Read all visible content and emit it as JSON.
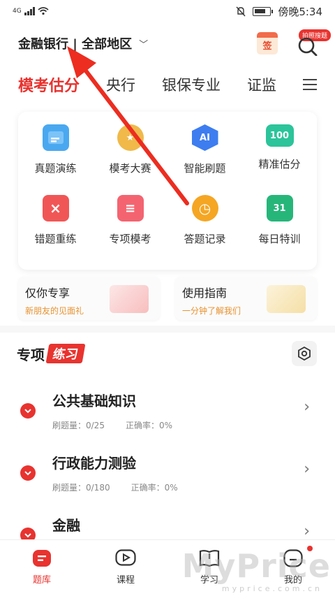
{
  "status_bar": {
    "network": "4G",
    "time": "傍晚5:34"
  },
  "header": {
    "region": "金融银行 | 全部地区",
    "calendar_label": "签",
    "photo_search_badge": "拍照搜题"
  },
  "tabs": [
    "模考估分",
    "央行",
    "银保专业",
    "证监"
  ],
  "grid": [
    {
      "label": "真题演练",
      "icon": "document-icon",
      "color": "#4aa8f0",
      "glyph": ""
    },
    {
      "label": "模考大赛",
      "icon": "medal-icon",
      "color": "#f0b94a",
      "glyph": "★"
    },
    {
      "label": "智能刷题",
      "icon": "ai-icon",
      "color": "#3d7df0",
      "glyph": "AI"
    },
    {
      "label": "精准估分",
      "icon": "score-icon",
      "color": "#2cc49a",
      "glyph": "100"
    },
    {
      "label": "错题重练",
      "icon": "error-icon",
      "color": "#f15656",
      "glyph": "×"
    },
    {
      "label": "专项模考",
      "icon": "certificate-icon",
      "color": "#f36470",
      "glyph": "≡"
    },
    {
      "label": "答题记录",
      "icon": "alarm-clock-icon",
      "color": "#f5a623",
      "glyph": "◷"
    },
    {
      "label": "每日特训",
      "icon": "calendar-icon",
      "color": "#27b67a",
      "glyph": "31"
    }
  ],
  "promos": [
    {
      "title": "仅你专享",
      "subtitle": "新朋友的见面礼"
    },
    {
      "title": "使用指南",
      "subtitle": "一分钟了解我们"
    }
  ],
  "section": {
    "title": "专项",
    "tag": "练习"
  },
  "subjects": [
    {
      "name": "公共基础知识",
      "count": "刷题量：0/25",
      "accuracy": "正确率：0%"
    },
    {
      "name": "行政能力测验",
      "count": "刷题量：0/180",
      "accuracy": "正确率：0%"
    },
    {
      "name": "金融",
      "count": "",
      "accuracy": ""
    }
  ],
  "bottom_nav": [
    {
      "label": "题库",
      "icon": "question-bank-icon"
    },
    {
      "label": "课程",
      "icon": "play-icon"
    },
    {
      "label": "学习",
      "icon": "book-icon"
    },
    {
      "label": "我的",
      "icon": "profile-icon"
    }
  ],
  "watermark": {
    "main": "MyPrice",
    "sub": "myprice.com.cn"
  },
  "colors": {
    "accent": "#e8332f",
    "annotation_arrow": "#ec2d20"
  }
}
